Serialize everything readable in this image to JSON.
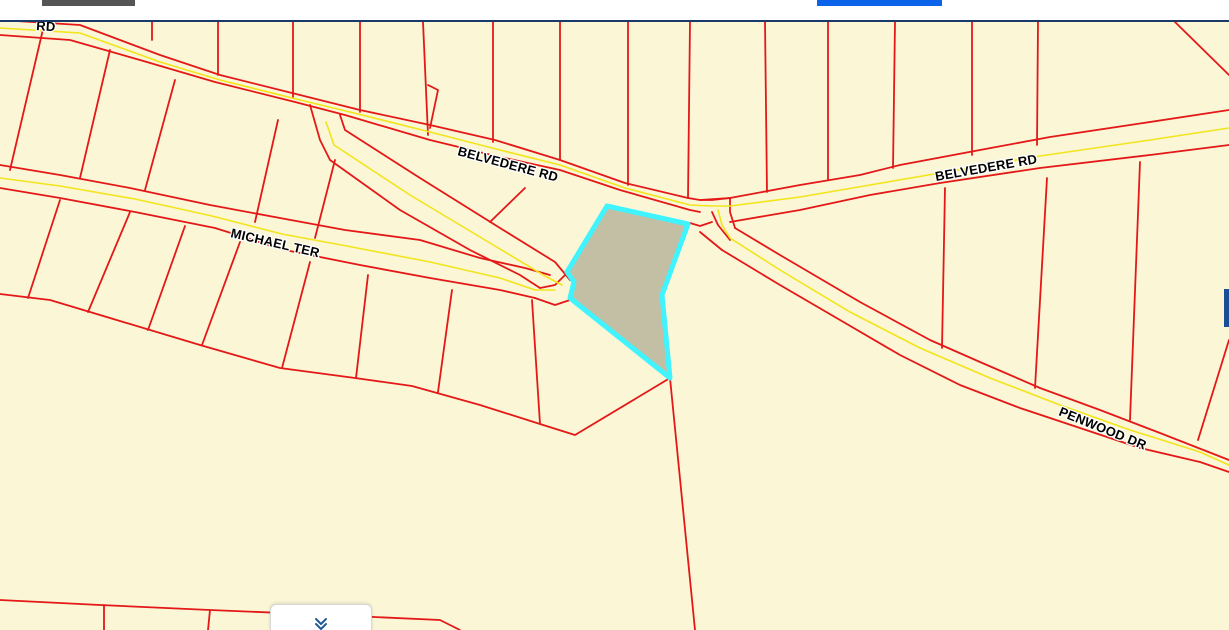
{
  "app": {
    "top_tabs": [
      {
        "name": "left-tab",
        "color": "#555555"
      },
      {
        "name": "active-tab",
        "color": "#0b63ea"
      }
    ]
  },
  "map": {
    "background_color": "#faf6d6",
    "parcel_line_color": "#e41818",
    "road_centerline_color": "#f2e51b",
    "highlight_outline_color": "#3ff3ff",
    "highlight_fill_color": "#c2bfa5",
    "streets": [
      {
        "id": "cut-off",
        "label": "RD"
      },
      {
        "id": "belvedere-west",
        "label": "BELVEDERE RD"
      },
      {
        "id": "belvedere-east",
        "label": "BELVEDERE RD"
      },
      {
        "id": "michael",
        "label": "MICHAEL TER"
      },
      {
        "id": "penwood",
        "label": "PENWOOD DR"
      }
    ]
  },
  "controls": {
    "collapse_icon": "double-chevron-down-icon"
  }
}
